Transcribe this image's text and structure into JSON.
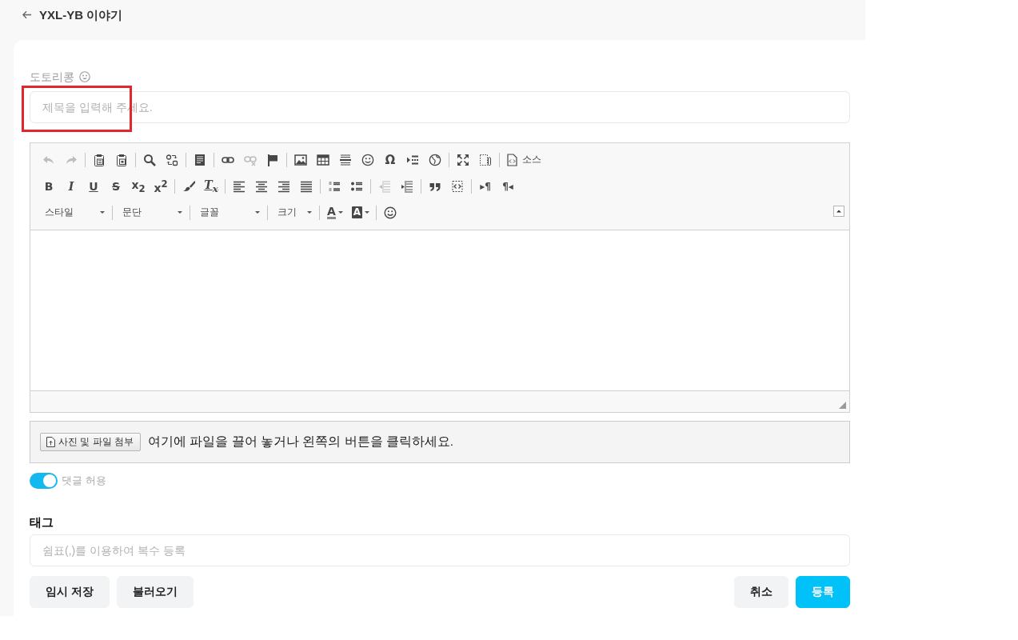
{
  "header": {
    "title": "YXL-YB 이야기"
  },
  "form": {
    "author": {
      "name": "도토리콩"
    },
    "title": {
      "placeholder": "제목을 입력해 주세요.",
      "highlighted": true
    },
    "editor": {
      "toolbar": [
        [
          [
            {
              "kind": "icon",
              "disabled": true
            },
            {
              "kind": "icon",
              "disabled": true
            }
          ],
          [
            {
              "kind": "icon",
              "disabled": false
            },
            {
              "kind": "icon",
              "disabled": false
            }
          ],
          [
            {
              "kind": "icon",
              "disabled": false
            },
            {
              "kind": "icon",
              "disabled": false
            }
          ],
          [
            {
              "kind": "icon",
              "disabled": false
            }
          ],
          [
            {
              "kind": "icon",
              "disabled": false
            },
            {
              "kind": "icon",
              "disabled": true
            },
            {
              "kind": "icon",
              "disabled": false
            }
          ],
          [
            {
              "kind": "icon",
              "disabled": false
            },
            {
              "kind": "icon",
              "disabled": false
            },
            {
              "kind": "icon",
              "disabled": false
            },
            {
              "kind": "icon",
              "disabled": false
            },
            {
              "kind": "glyph",
              "glyph": "Ω",
              "disabled": false
            },
            {
              "kind": "icon",
              "disabled": false
            },
            {
              "kind": "icon",
              "disabled": false
            }
          ],
          [
            {
              "kind": "icon",
              "disabled": false
            },
            {
              "kind": "icon",
              "disabled": false
            }
          ],
          [
            {
              "kind": "source",
              "label": "소스",
              "disabled": false
            }
          ]
        ],
        [
          [
            {
              "kind": "glyph",
              "glyph": "B",
              "disabled": false
            },
            {
              "kind": "glyph",
              "glyph": "I",
              "disabled": false
            },
            {
              "kind": "glyph",
              "glyph": "U",
              "disabled": false
            },
            {
              "kind": "glyph",
              "glyph": "S",
              "disabled": false
            },
            {
              "kind": "glyph",
              "glyph": "x$_{2}$",
              "disabled": false
            },
            {
              "kind": "glyph",
              "glyph": "x$^{2}$",
              "disabled": false
            }
          ],
          [
            {
              "kind": "icon",
              "disabled": false
            },
            {
              "kind": "glyph",
              "glyph": "T$_{x}$",
              "disabled": false
            }
          ],
          [
            {
              "kind": "icon",
              "disabled": false
            },
            {
              "kind": "icon",
              "disabled": false
            },
            {
              "kind": "icon",
              "disabled": false
            },
            {
              "kind": "icon",
              "disabled": false
            }
          ],
          [
            {
              "kind": "icon",
              "disabled": false
            },
            {
              "kind": "icon",
              "disabled": false
            }
          ],
          [
            {
              "kind": "icon",
              "disabled": true
            },
            {
              "kind": "icon",
              "disabled": false
            }
          ],
          [
            {
              "kind": "icon",
              "disabled": false
            },
            {
              "kind": "icon",
              "disabled": false
            }
          ],
          [
            {
              "kind": "glyph",
              "glyph": "▸¶",
              "disabled": false
            },
            {
              "kind": "glyph",
              "glyph": "¶◂",
              "disabled": false
            }
          ]
        ],
        [
          [
            {
              "kind": "combo",
              "label": "스타일",
              "disabled": false
            }
          ],
          [
            {
              "kind": "combo",
              "label": "문단",
              "disabled": false
            }
          ],
          [
            {
              "kind": "combo",
              "label": "글꼴",
              "disabled": false
            }
          ],
          [
            {
              "kind": "combo",
              "label": "크기",
              "disabled": false
            }
          ],
          [
            {
              "kind": "fontcolor",
              "glyph": "A",
              "disabled": false
            },
            {
              "kind": "bgcolor",
              "glyph": "A",
              "disabled": false
            }
          ],
          [
            {
              "kind": "icon",
              "disabled": false
            }
          ]
        ]
      ]
    },
    "attachment": {
      "button": "사진 및 파일 첨부",
      "hint": "여기에 파일을 끌어 놓거나 왼쪽의 버튼을 클릭하세요."
    },
    "comments": {
      "label": "댓글 허용",
      "on": true
    },
    "tags": {
      "label": "태그",
      "placeholder": "쉼표(,)를 이용하여 복수 등록"
    },
    "left_buttons": [
      {
        "label": "임시 저장",
        "kind": "secondary"
      },
      {
        "label": "불러오기",
        "kind": "secondary"
      }
    ],
    "right_buttons": [
      {
        "label": "취소",
        "kind": "secondary"
      },
      {
        "label": "등록",
        "kind": "primary"
      }
    ]
  }
}
